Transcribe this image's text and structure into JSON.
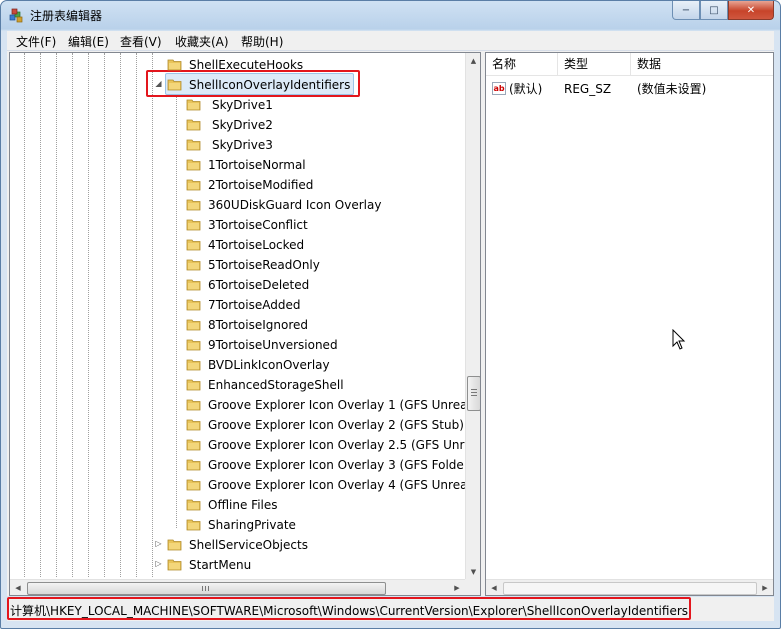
{
  "window": {
    "title": "注册表编辑器"
  },
  "caption_buttons": {
    "minimize": "−",
    "maximize": "□",
    "close": "✕"
  },
  "menu": [
    "文件(F)",
    "编辑(E)",
    "查看(V)",
    "收藏夹(A)",
    "帮助(H)"
  ],
  "tree": {
    "items": [
      "ShellExecuteHooks",
      "ShellIconOverlayIdentifiers",
      "SkyDrive1",
      "SkyDrive2",
      "SkyDrive3",
      "1TortoiseNormal",
      "2TortoiseModified",
      "360UDiskGuard Icon Overlay",
      "3TortoiseConflict",
      "4TortoiseLocked",
      "5TortoiseReadOnly",
      "6TortoiseDeleted",
      "7TortoiseAdded",
      "8TortoiseIgnored",
      "9TortoiseUnversioned",
      "BVDLinkIconOverlay",
      "EnhancedStorageShell",
      "Groove Explorer Icon Overlay 1 (GFS Unrea",
      "Groove Explorer Icon Overlay 2 (GFS Stub)",
      "Groove Explorer Icon Overlay 2.5 (GFS Unr",
      "Groove Explorer Icon Overlay 3 (GFS Folde",
      "Groove Explorer Icon Overlay 4 (GFS Unrea",
      "Offline Files",
      "SharingPrivate",
      "ShellServiceObjects",
      "StartMenu"
    ]
  },
  "list": {
    "columns": [
      "名称",
      "类型",
      "数据"
    ],
    "rows": [
      {
        "name": "(默认)",
        "type": "REG_SZ",
        "data": "(数值未设置)",
        "icon": "ab"
      }
    ]
  },
  "status": {
    "path": "计算机\\HKEY_LOCAL_MACHINE\\SOFTWARE\\Microsoft\\Windows\\CurrentVersion\\Explorer\\ShellIconOverlayIdentifiers"
  },
  "colors": {
    "highlight": "#e3161d",
    "selection": "#dceaf8",
    "folder": "#e8c45a"
  }
}
